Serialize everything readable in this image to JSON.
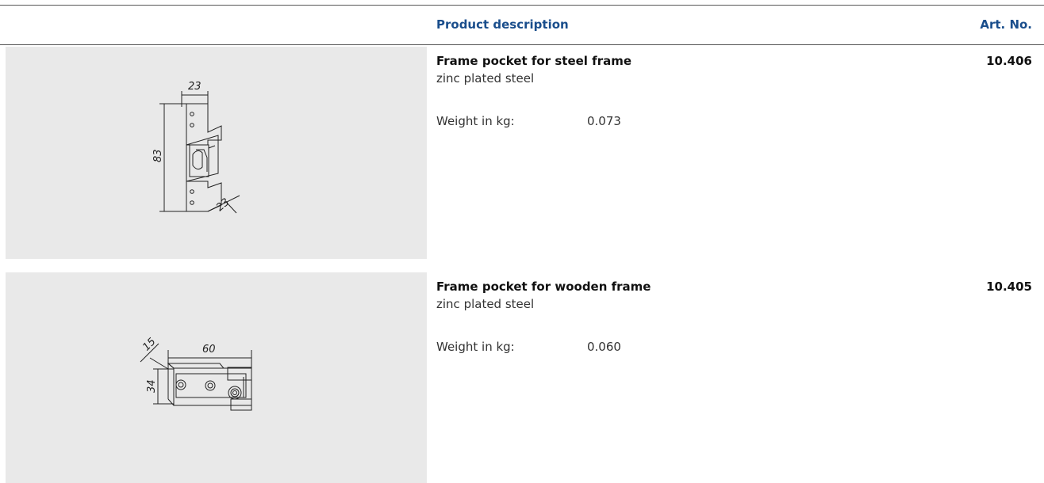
{
  "header": {
    "product_description": "Product description",
    "art_no": "Art. No."
  },
  "products": [
    {
      "name": "Frame pocket for steel frame",
      "material": "zinc plated steel",
      "weight_label": "Weight in kg:",
      "weight_value": "0.073",
      "art_no": "10.406",
      "drawing": {
        "dim_width": "23",
        "dim_height": "83",
        "dim_depth": "23"
      }
    },
    {
      "name": "Frame pocket for wooden frame",
      "material": "zinc plated steel",
      "weight_label": "Weight in kg:",
      "weight_value": "0.060",
      "art_no": "10.405",
      "drawing": {
        "dim_depth": "15",
        "dim_width": "60",
        "dim_height": "34"
      }
    }
  ],
  "colors": {
    "header_text": "#1a4e8c",
    "panel_bg": "#e9e9e9"
  }
}
